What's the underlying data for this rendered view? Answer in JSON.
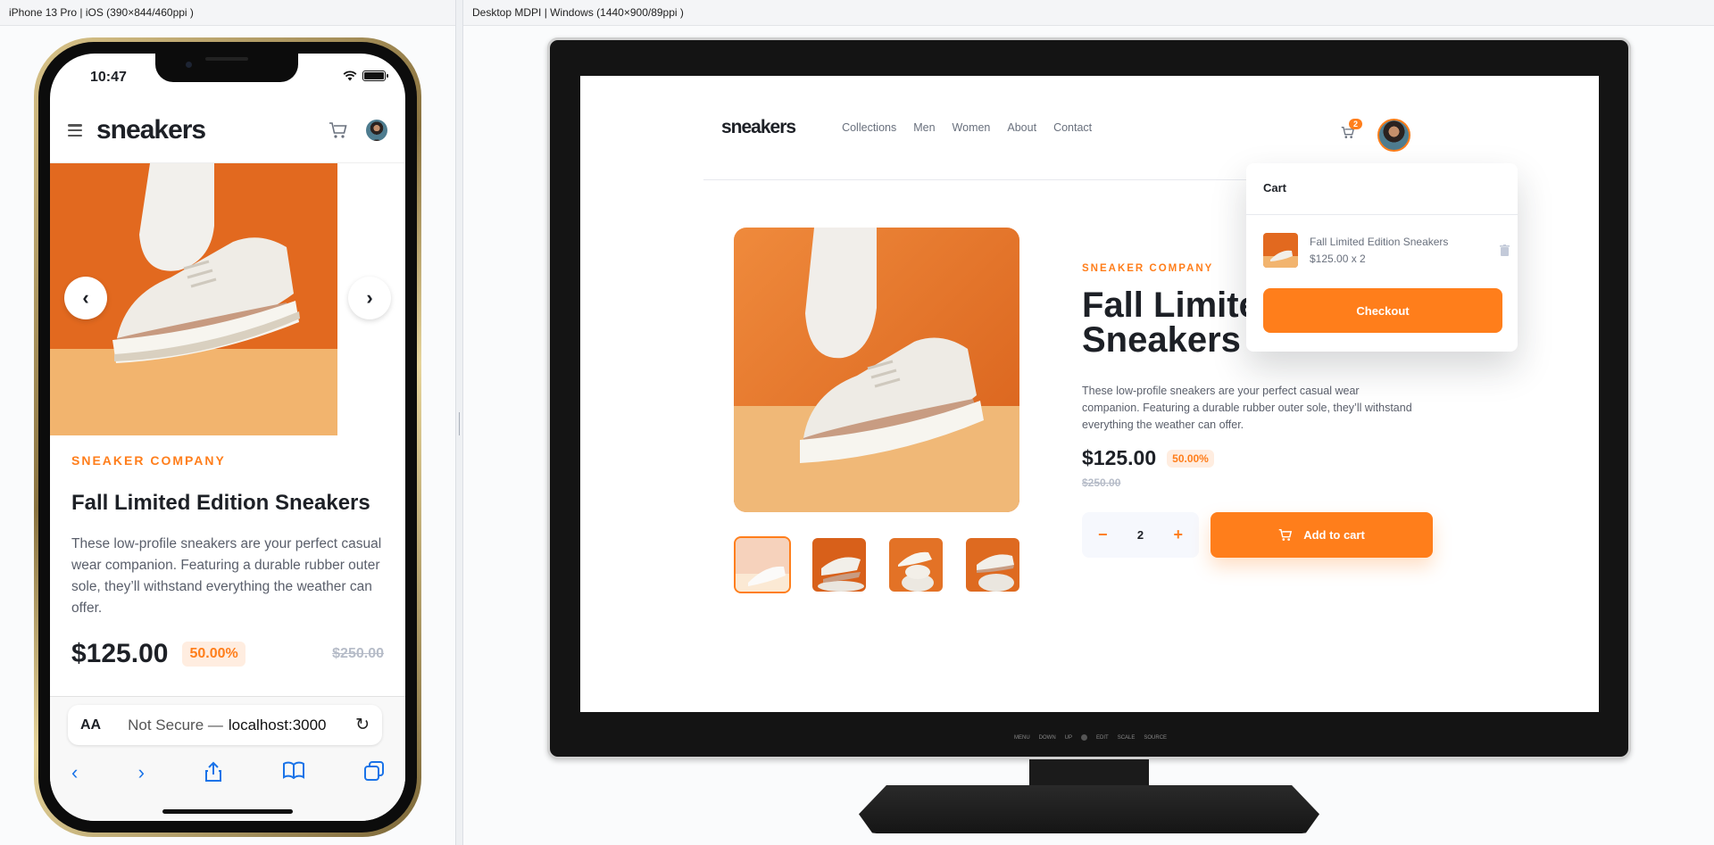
{
  "devices": {
    "left_label": "iPhone 13 Pro | iOS (390×844/460ppi )",
    "right_label": "Desktop MDPI | Windows (1440×900/89ppi )"
  },
  "mobile": {
    "status_time": "10:47",
    "logo": "sneakers",
    "company": "SNEAKER COMPANY",
    "title": "Fall Limited Edition Sneakers",
    "description": "These low-profile sneakers are your perfect casual wear companion. Featuring a durable rubber outer sole, they’ll withstand everything the weather can offer.",
    "price": "$125.00",
    "discount": "50.00%",
    "old_price": "$250.00",
    "browser": {
      "aa": "AA",
      "security": "Not Secure —",
      "host": "localhost:3000"
    }
  },
  "desktop": {
    "logo": "sneakers",
    "nav": [
      "Collections",
      "Men",
      "Women",
      "About",
      "Contact"
    ],
    "cart_count": "2",
    "company": "SNEAKER COMPANY",
    "title_line1": "Fall Limited Edition",
    "title_line2": "Sneakers",
    "description": "These low-profile sneakers are your perfect casual wear companion. Featuring a durable rubber outer sole, they’ll withstand everything the weather can offer.",
    "price": "$125.00",
    "discount": "50.00%",
    "old_price": "$250.00",
    "quantity": "2",
    "qty_minus": "−",
    "qty_plus": "+",
    "add_to_cart": "Add to cart",
    "cart": {
      "title": "Cart",
      "item_name": "Fall Limited Edition Sneakers",
      "item_price": "$125.00 x 2",
      "checkout": "Checkout"
    },
    "monitor_buttons": [
      "MENU",
      "DOWN",
      "UP",
      "EDIT",
      "SCALE",
      "SOURCE"
    ]
  },
  "colors": {
    "accent": "#ff7e1b",
    "accent_pale": "#ffede0",
    "text_dark": "#1d2026",
    "text_gray": "#69707d"
  },
  "icons": [
    "menu-icon",
    "cart-icon",
    "chevron-left-icon",
    "chevron-right-icon",
    "reload-icon",
    "share-icon",
    "book-icon",
    "tabs-icon",
    "trash-icon",
    "wifi-icon",
    "battery-icon"
  ]
}
